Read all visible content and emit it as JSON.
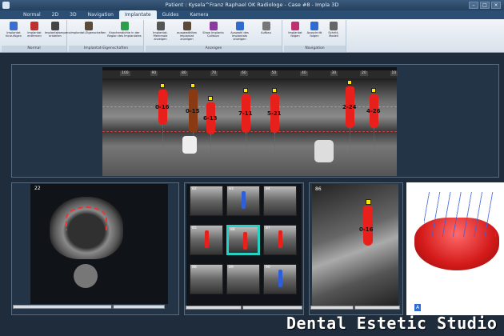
{
  "window": {
    "title": "Patient : Kysela^Franz Raphael OK Radiologe - Case #8 - Impla 3D"
  },
  "tabs": [
    {
      "label": "Normal"
    },
    {
      "label": "2D"
    },
    {
      "label": "3D"
    },
    {
      "label": "Navigation"
    },
    {
      "label": "Implantate",
      "active": true
    },
    {
      "label": "Guides"
    },
    {
      "label": "Kamera"
    }
  ],
  "ribbon": {
    "groups": [
      {
        "caption": "Normal",
        "buttons": [
          {
            "label": "Implantat hinzufügen",
            "icon": "implant-add-icon"
          },
          {
            "label": "Implantat entfernen",
            "icon": "implant-remove-icon"
          },
          {
            "label": "Implantatsequenz erstellen",
            "icon": "implant-sequence-icon"
          }
        ]
      },
      {
        "caption": "Implantat-Eigenschaften",
        "buttons": [
          {
            "label": "Implantat-Eigenschaften",
            "icon": "implant-properties-icon"
          },
          {
            "label": "Knochendichte in der Region des Implantates",
            "icon": "bone-density-icon"
          }
        ]
      },
      {
        "caption": "Anzeigen",
        "buttons": [
          {
            "label": "Implantat-Merkmale anzeigen",
            "icon": "implant-features-icon"
          },
          {
            "label": "ausgewähltes Implantat anzeigen",
            "icon": "selected-implant-icon"
          },
          {
            "label": "Show Implants Collision",
            "icon": "collision-icon"
          },
          {
            "label": "Auswahl des Implantats anzeigen",
            "icon": "implant-selection-icon"
          },
          {
            "label": "Aufbau",
            "icon": "abutment-icon"
          }
        ]
      },
      {
        "caption": "Navigation",
        "buttons": [
          {
            "label": "Implantat folgen",
            "icon": "follow-implant-icon"
          },
          {
            "label": "Ausschnitt folgen",
            "icon": "follow-section-icon"
          },
          {
            "label": "Schritt-Modell",
            "icon": "step-model-icon"
          }
        ]
      }
    ]
  },
  "panorama": {
    "ruler_ticks": [
      "100",
      "90",
      "80",
      "70",
      "60",
      "50",
      "40",
      "30",
      "20",
      "10"
    ],
    "implants": [
      {
        "label": "0-16",
        "color": "#e8201c"
      },
      {
        "label": "0-15",
        "color": "#8a3a12"
      },
      {
        "label": "6-13",
        "color": "#e8201c"
      },
      {
        "label": "7-11",
        "color": "#e8201c"
      },
      {
        "label": "5-21",
        "color": "#e8201c"
      },
      {
        "label": "2-24",
        "color": "#e8201c"
      },
      {
        "label": "4-26",
        "color": "#e8201c"
      }
    ]
  },
  "axial": {
    "slice_number": "22"
  },
  "crosssections": {
    "thumbnails": [
      {
        "num": "82",
        "mark": "none"
      },
      {
        "num": "83",
        "mark": "blue"
      },
      {
        "num": "84",
        "mark": "none"
      },
      {
        "num": "85",
        "mark": "red"
      },
      {
        "num": "86",
        "mark": "red",
        "selected": true
      },
      {
        "num": "87",
        "mark": "red"
      },
      {
        "num": "88",
        "mark": "none"
      },
      {
        "num": "89",
        "mark": "none"
      },
      {
        "num": "90",
        "mark": "blue"
      }
    ]
  },
  "detail": {
    "slice_number": "86",
    "implant_label": "0-16"
  },
  "model3d": {
    "corner_label": "A"
  },
  "watermark": "Dental Estetic Studio",
  "colors": {
    "implant": "#e8201c",
    "implant_alt": "#8a3a12",
    "cap": "#ffe600",
    "select_frame": "#27d1c4",
    "guide_line": "#43d443"
  }
}
